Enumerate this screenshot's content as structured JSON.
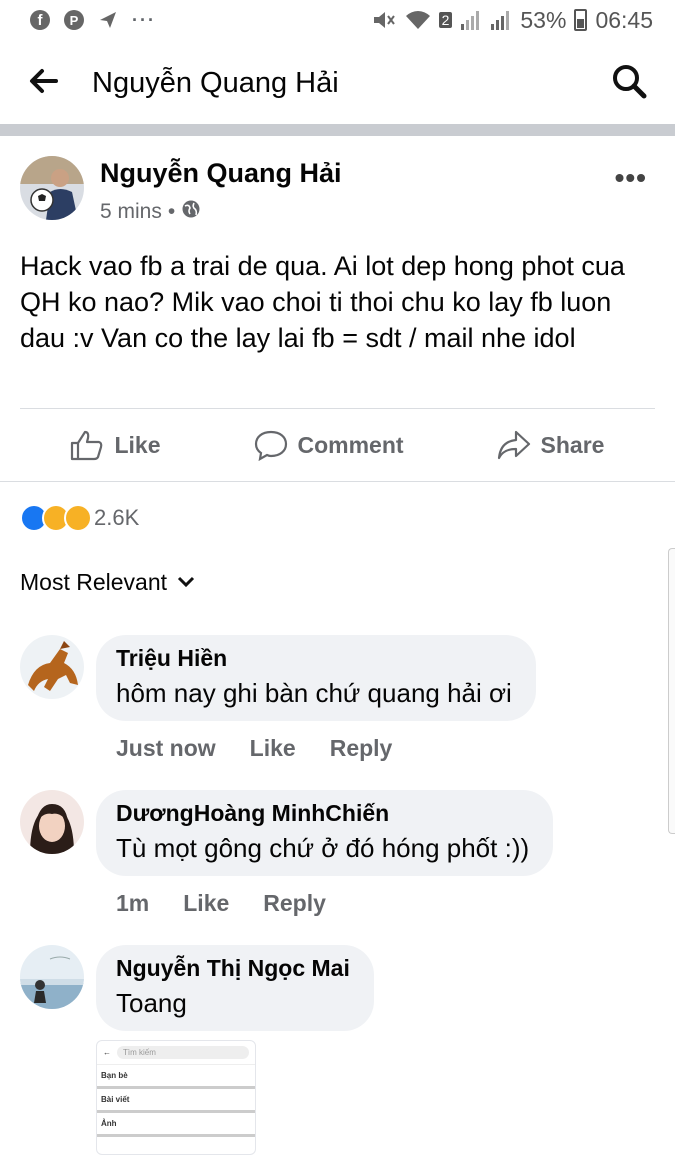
{
  "status_bar": {
    "battery": "53%",
    "time": "06:45",
    "sim_badge": "2",
    "dots": "···"
  },
  "header": {
    "title": "Nguyễn Quang Hải"
  },
  "post": {
    "author": "Nguyễn Quang Hải",
    "time": "5 mins",
    "separator": "•",
    "text": "Hack vao fb a trai de qua. Ai lot dep hong phot cua QH ko nao? Mik vao choi ti thoi chu ko lay fb luon dau :v Van co the lay lai fb = sdt / mail nhe idol",
    "actions": {
      "like": "Like",
      "comment": "Comment",
      "share": "Share"
    },
    "reaction_count": "2.6K",
    "sort_label": "Most Relevant"
  },
  "comments": [
    {
      "name": "Triệu Hiền",
      "text": "hôm nay ghi bàn chứ quang hải ơi",
      "time": "Just now",
      "like": "Like",
      "reply": "Reply"
    },
    {
      "name": "DươngHoàng MinhChiến",
      "text": "Tù mọt gông chứ ở đó hóng phốt :))",
      "time": "1m",
      "like": "Like",
      "reply": "Reply"
    },
    {
      "name": "Nguyễn Thị Ngọc Mai",
      "text": "Toang"
    }
  ],
  "attachment": {
    "search_placeholder": "Tìm kiếm",
    "rows": [
      "Bạn bè",
      "Bài viết",
      "Ảnh"
    ]
  },
  "colors": {
    "secondary_text": "#65676b",
    "bubble": "#f0f2f5",
    "divider": "#c9ccd1",
    "like_blue": "#1877f2"
  }
}
